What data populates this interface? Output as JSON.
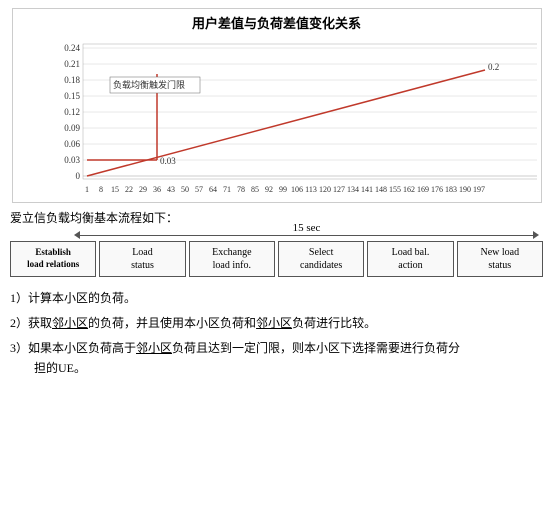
{
  "chart": {
    "title": "用户差值与负荷差值变化关系",
    "y_labels": [
      "0.24",
      "0.21",
      "0.18",
      "0.15",
      "0.12",
      "0.09",
      "0.06",
      "0.03",
      "0"
    ],
    "x_labels": [
      "1",
      "8",
      "15",
      "22",
      "29",
      "36",
      "43",
      "50",
      "57",
      "64",
      "71",
      "78",
      "85",
      "92",
      "99",
      "106",
      "113",
      "120",
      "127",
      "134",
      "141",
      "148",
      "155",
      "162",
      "169",
      "176",
      "183",
      "190",
      "197"
    ],
    "annotation_text": "负载均衡触发门限",
    "line_start_label": "0.03",
    "line_end_label": "0.2"
  },
  "flow": {
    "title_prefix": "爱立信负载均衡基本流程如下：",
    "arrow_label": "15 sec",
    "boxes": [
      {
        "label": "Establish\nload relations"
      },
      {
        "label": "Load\nstatus"
      },
      {
        "label": "Exchange\nload info."
      },
      {
        "label": "Select\ncandidates"
      },
      {
        "label": "Load bal.\naction"
      },
      {
        "label": "New load\nstatus"
      }
    ]
  },
  "text": {
    "para1": "1）计算本小区的负荷。",
    "para2_parts": {
      "before": "2）获取",
      "u1": "邻小区",
      "mid": "的负荷，并且使用本小区负荷和",
      "u2": "邻小区",
      "after": "负荷进行比较。"
    },
    "para3_parts": {
      "before": "3）如果本小区负荷高于",
      "u1": "邻小区",
      "mid": "负荷且达到一定门限，则本小区下选择需要进行负荷分",
      "newline": "担的UE。"
    }
  }
}
